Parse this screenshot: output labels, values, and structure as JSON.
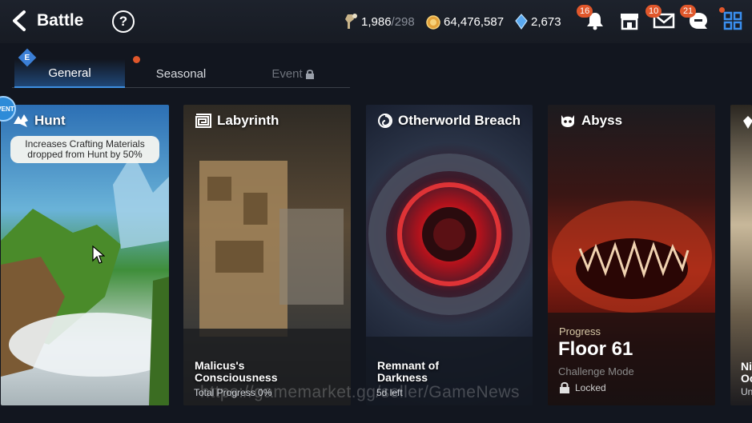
{
  "header": {
    "title": "Battle",
    "help": "?",
    "resources": [
      {
        "icon": "stamina-key-icon",
        "value": "1,986",
        "max": "/298"
      },
      {
        "icon": "gold-coin-icon",
        "value": "64,476,587"
      },
      {
        "icon": "skystone-icon",
        "value": "2,673"
      }
    ],
    "notifications": {
      "bell": "16",
      "mail": "10",
      "chat": "21"
    }
  },
  "tabs": {
    "general": "General",
    "seasonal": "Seasonal",
    "event": "Event",
    "general_badge": "E"
  },
  "cards": {
    "hunt": {
      "title": "Hunt",
      "event_badge": "VENT",
      "tip": "Increases Crafting Materials dropped from Hunt by 50%"
    },
    "labyrinth": {
      "title": "Labyrinth",
      "name": "Malicus's Consciousness",
      "sub": "Total Progress 0%"
    },
    "breach": {
      "title": "Otherworld Breach",
      "name": "Remnant of Darkness",
      "sub": "5d left"
    },
    "abyss": {
      "title": "Abyss",
      "progress_label": "Progress",
      "floor": "Floor 61",
      "mode": "Challenge Mode",
      "status": "Locked"
    },
    "next": {
      "name_line1": "Ni",
      "name_line2": "Oc",
      "sub": "Un"
    }
  },
  "watermark": "https://gamemarket.gg/seller/GameNews",
  "colors": {
    "accent": "#3e8fe0",
    "badge": "#e0572b",
    "tab_bg": "#2b6ebe"
  }
}
